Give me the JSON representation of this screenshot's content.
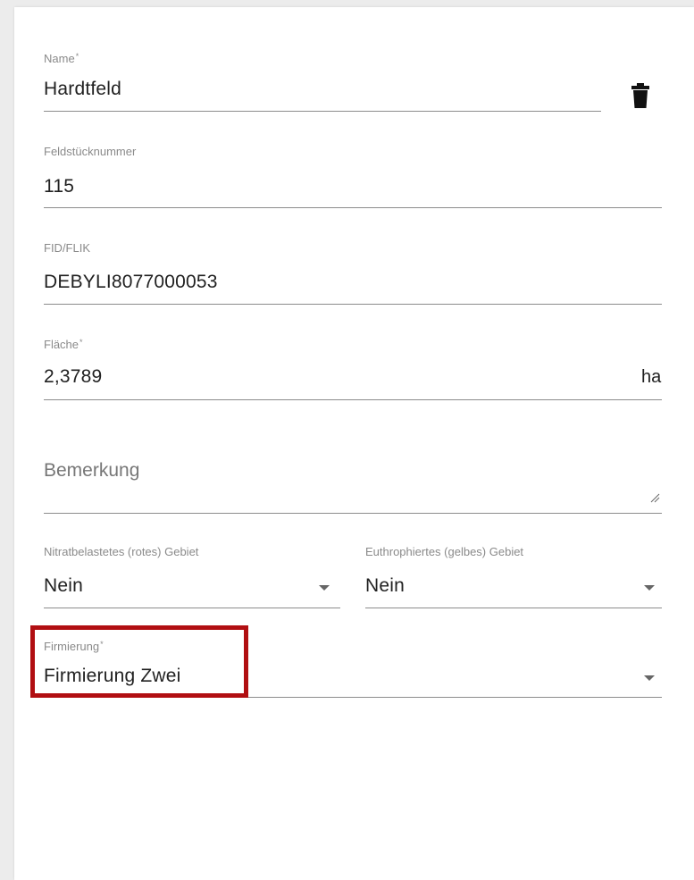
{
  "form": {
    "name": {
      "label": "Name",
      "required_mark": "*",
      "value": "Hardtfeld"
    },
    "delete_icon": "trash-icon",
    "feldstuecknummer": {
      "label": "Feldstücknummer",
      "value": "115"
    },
    "fid_flik": {
      "label": "FID/FLIK",
      "value": "DEBYLI8077000053"
    },
    "flaeche": {
      "label": "Fläche",
      "required_mark": "*",
      "value": "2,3789",
      "unit": "ha"
    },
    "bemerkung": {
      "placeholder": "Bemerkung"
    },
    "nitrat": {
      "label": "Nitratbelastetes (rotes) Gebiet",
      "value": "Nein"
    },
    "euthroph": {
      "label": "Euthrophiertes (gelbes) Gebiet",
      "value": "Nein"
    },
    "firmierung": {
      "label": "Firmierung",
      "required_mark": "*",
      "value": "Firmierung Zwei"
    }
  },
  "colors": {
    "highlight": "#b10f12",
    "underline": "#8c8c8c",
    "label": "#8a8a8a",
    "text": "#212121"
  }
}
